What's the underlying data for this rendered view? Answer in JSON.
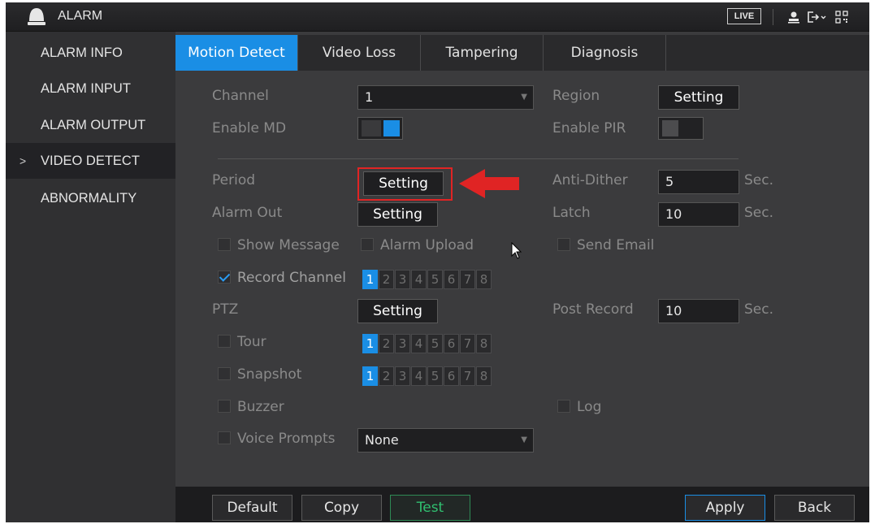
{
  "app": {
    "title": "ALARM",
    "live_label": "LIVE"
  },
  "icons": {
    "logo": "alarm-bell-icon",
    "user": "user-icon",
    "logout": "logout-icon",
    "qr": "qr-code-icon",
    "submenu_arrow": "chevron-right-icon"
  },
  "sidebar": {
    "items": [
      {
        "label": "ALARM INFO"
      },
      {
        "label": "ALARM INPUT"
      },
      {
        "label": "ALARM OUTPUT"
      },
      {
        "label": "VIDEO DETECT",
        "active": true,
        "marker": ">"
      },
      {
        "label": "ABNORMALITY"
      }
    ]
  },
  "tabs": [
    {
      "label": "Motion Detect",
      "active": true
    },
    {
      "label": "Video Loss"
    },
    {
      "label": "Tampering"
    },
    {
      "label": "Diagnosis"
    }
  ],
  "form": {
    "channel": {
      "label": "Channel",
      "value": "1"
    },
    "region": {
      "label": "Region",
      "button": "Setting"
    },
    "enable_md": {
      "label": "Enable MD",
      "on": true
    },
    "enable_pir": {
      "label": "Enable PIR",
      "on": false
    },
    "period": {
      "label": "Period",
      "button": "Setting"
    },
    "anti_dither": {
      "label": "Anti-Dither",
      "value": "5",
      "unit": "Sec."
    },
    "alarm_out": {
      "label": "Alarm Out",
      "button": "Setting"
    },
    "latch": {
      "label": "Latch",
      "value": "10",
      "unit": "Sec."
    },
    "show_message": {
      "label": "Show Message",
      "checked": false
    },
    "alarm_upload": {
      "label": "Alarm Upload",
      "checked": false
    },
    "send_email": {
      "label": "Send Email",
      "checked": false
    },
    "record_channel": {
      "label": "Record Channel",
      "checked": true,
      "channels": [
        "1",
        "2",
        "3",
        "4",
        "5",
        "6",
        "7",
        "8"
      ],
      "selected": [
        "1"
      ]
    },
    "ptz": {
      "label": "PTZ",
      "button": "Setting"
    },
    "post_record": {
      "label": "Post Record",
      "value": "10",
      "unit": "Sec."
    },
    "tour": {
      "label": "Tour",
      "checked": false,
      "channels": [
        "1",
        "2",
        "3",
        "4",
        "5",
        "6",
        "7",
        "8"
      ],
      "selected": [
        "1"
      ]
    },
    "snapshot": {
      "label": "Snapshot",
      "checked": false,
      "channels": [
        "1",
        "2",
        "3",
        "4",
        "5",
        "6",
        "7",
        "8"
      ],
      "selected": [
        "1"
      ]
    },
    "buzzer": {
      "label": "Buzzer",
      "checked": false
    },
    "log": {
      "label": "Log",
      "checked": false
    },
    "voice_prompts": {
      "label": "Voice Prompts",
      "checked": false,
      "value": "None"
    }
  },
  "footer": {
    "default": "Default",
    "copy": "Copy",
    "test": "Test",
    "apply": "Apply",
    "back": "Back"
  },
  "colors": {
    "accent": "#1a8ee5",
    "annotation": "#e02424",
    "test": "#30c070"
  }
}
